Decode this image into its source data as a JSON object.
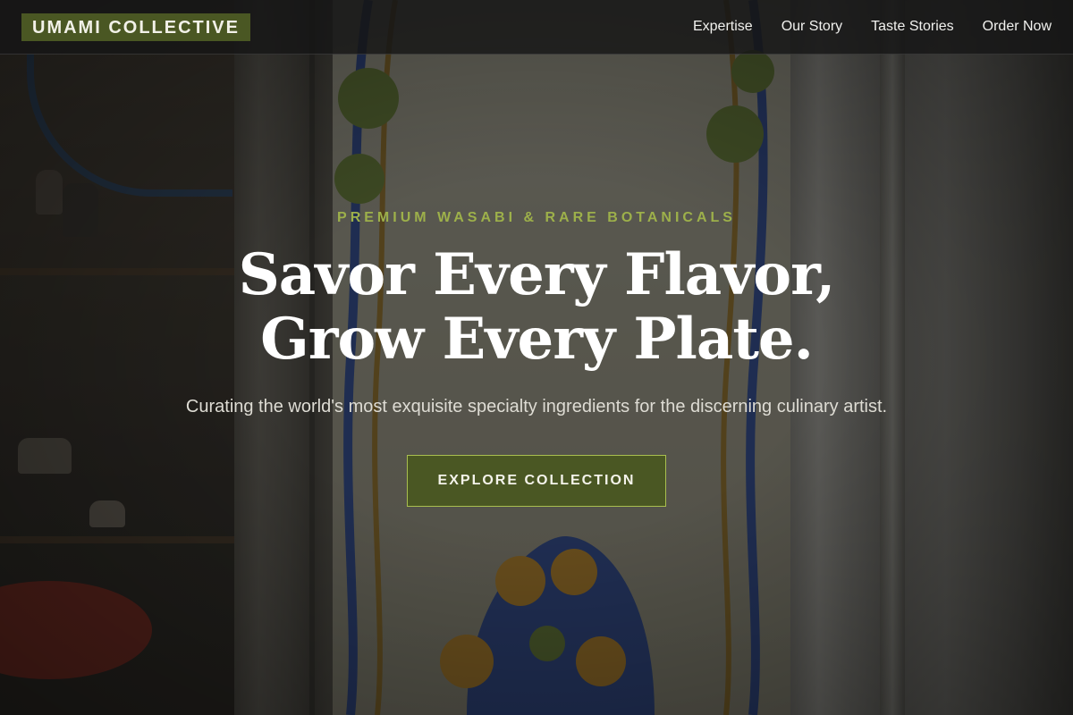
{
  "colors": {
    "accent_green": "#4a5723",
    "eyebrow_green": "#9db04a",
    "header_bg": "#161616",
    "text_light": "#ffffff"
  },
  "header": {
    "brand": "UMAMI COLLECTIVE",
    "nav": [
      {
        "label": "Expertise"
      },
      {
        "label": "Our Story"
      },
      {
        "label": "Taste Stories"
      },
      {
        "label": "Order Now"
      }
    ]
  },
  "hero": {
    "eyebrow": "PREMIUM WASABI & RARE BOTANICALS",
    "title_line1": "Savor Every Flavor,",
    "title_line2": "Grow Every Plate.",
    "subtitle": "Curating the world's most exquisite specialty ingredients for the discerning culinary artist.",
    "cta_label": "EXPLORE COLLECTION"
  }
}
